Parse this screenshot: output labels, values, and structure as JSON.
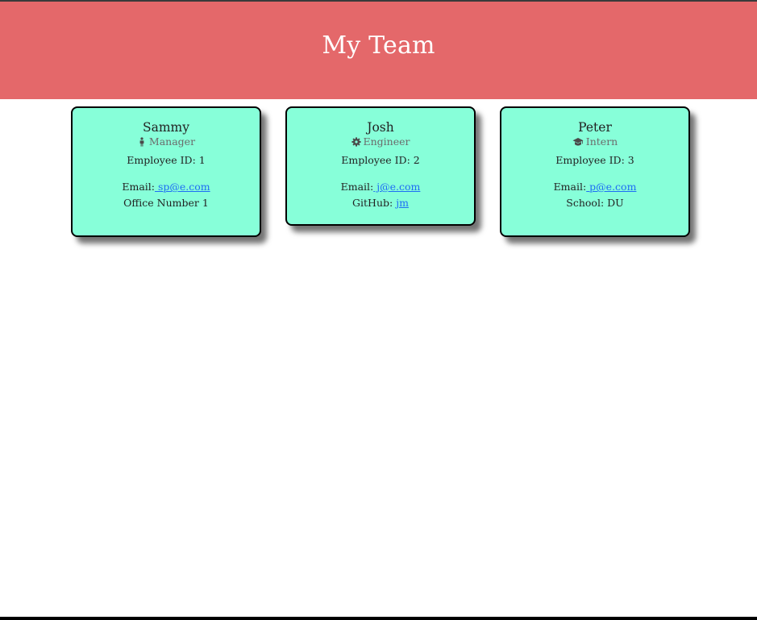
{
  "header": {
    "title": "My Team"
  },
  "colors": {
    "header_bg": "#e4686a",
    "card_bg": "#87ffd9",
    "link": "#1e6ef4"
  },
  "cards": [
    {
      "name": "Sammy",
      "role": "Manager",
      "role_icon": "person-icon",
      "id_label": "Employee ID: 1",
      "email_label": "Email:",
      "email": " sp@e.com",
      "extra": "Office Number 1"
    },
    {
      "name": "Josh",
      "role": "Engineer",
      "role_icon": "gear-icon",
      "id_label": "Employee ID: 2",
      "email_label": "Email:",
      "email": " j@e.com",
      "extra_label": "GitHub:",
      "extra_link": "jm"
    },
    {
      "name": "Peter",
      "role": "Intern",
      "role_icon": "graduation-cap-icon",
      "id_label": "Employee ID: 3",
      "email_label": "Email:",
      "email": " p@e.com",
      "extra": "School: DU"
    }
  ]
}
